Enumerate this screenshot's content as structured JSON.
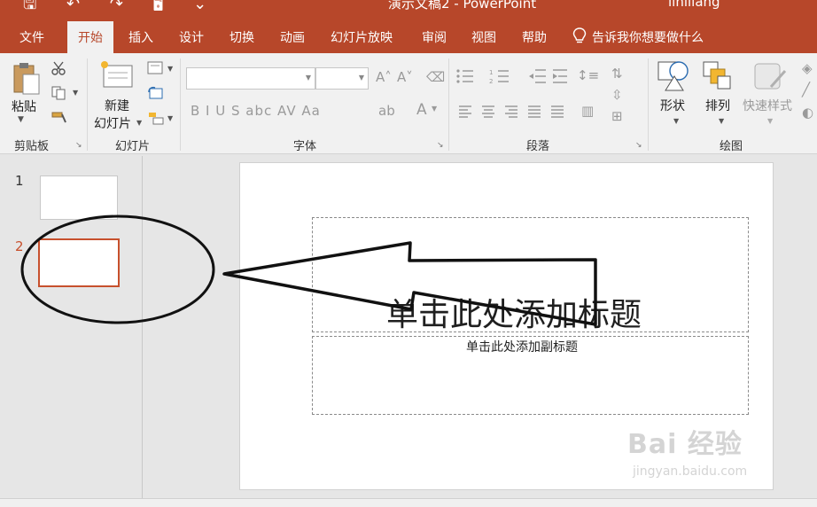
{
  "titlebar": {
    "quick_access": "🖫 ↶ ↷ 🖥 ⌄",
    "title": "演示文稿2 - PowerPoint",
    "user": "linlliang"
  },
  "tabs": [
    {
      "label": "文件"
    },
    {
      "label": "开始"
    },
    {
      "label": "插入"
    },
    {
      "label": "设计"
    },
    {
      "label": "切换"
    },
    {
      "label": "动画"
    },
    {
      "label": "幻灯片放映"
    },
    {
      "label": "审阅"
    },
    {
      "label": "视图"
    },
    {
      "label": "帮助"
    },
    {
      "label": "告诉我你想要做什么"
    }
  ],
  "ribbon": {
    "clipboard": {
      "label": "剪贴板",
      "paste_label": "粘贴"
    },
    "slides": {
      "label": "幻灯片",
      "new_slide_line1": "新建",
      "new_slide_line2": "幻灯片"
    },
    "font": {
      "label": "字体",
      "font_name": "",
      "font_size": "",
      "format_buttons": "B  I  U  S  abc  AV  Aa",
      "color_buttons": "A"
    },
    "paragraph": {
      "label": "段落"
    },
    "drawing": {
      "label": "绘图",
      "shape_label": "形状",
      "arrange_label": "排列",
      "quick_style_label": "快速样式"
    }
  },
  "thumbnails": [
    {
      "number": "1"
    },
    {
      "number": "2"
    }
  ],
  "slide": {
    "title_placeholder": "单击此处添加标题",
    "subtitle_placeholder": "单击此处添加副标题"
  },
  "watermark": {
    "brand": "Bai 经验",
    "url": "jingyan.baidu.com"
  },
  "colors": {
    "accent": "#b7472a",
    "selected_thumb": "#c7502d"
  }
}
